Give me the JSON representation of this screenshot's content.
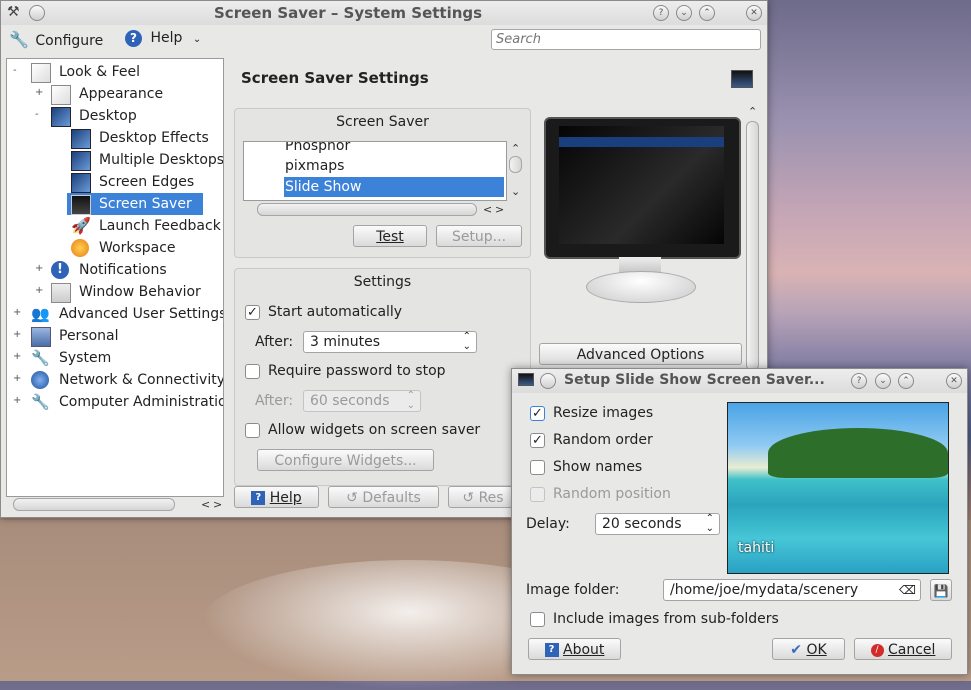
{
  "main_window": {
    "title": "Screen Saver – System Settings",
    "toolbar": {
      "configure": "Configure",
      "help": "Help"
    },
    "search": {
      "placeholder": "Search"
    },
    "tree": {
      "items": [
        {
          "label": "Look & Feel",
          "icon": "look-feel-icon",
          "level": 0
        },
        {
          "label": "Appearance",
          "icon": "appearance-icon",
          "level": 1
        },
        {
          "label": "Desktop",
          "icon": "desktop-icon",
          "level": 1
        },
        {
          "label": "Desktop Effects",
          "icon": "desktop-effects-icon",
          "level": 2
        },
        {
          "label": "Multiple Desktops",
          "icon": "multiple-desktops-icon",
          "level": 2
        },
        {
          "label": "Screen Edges",
          "icon": "screen-edges-icon",
          "level": 2
        },
        {
          "label": "Screen Saver",
          "icon": "screen-saver-icon",
          "level": 2,
          "selected": true
        },
        {
          "label": "Launch Feedback",
          "icon": "launch-feedback-icon",
          "level": 2
        },
        {
          "label": "Workspace",
          "icon": "workspace-icon",
          "level": 2
        },
        {
          "label": "Notifications",
          "icon": "notifications-icon",
          "level": 1
        },
        {
          "label": "Window Behavior",
          "icon": "window-behavior-icon",
          "level": 1
        },
        {
          "label": "Advanced User Settings",
          "icon": "advanced-user-settings-icon",
          "level": 0
        },
        {
          "label": "Personal",
          "icon": "personal-icon",
          "level": 0
        },
        {
          "label": "System",
          "icon": "system-icon",
          "level": 0
        },
        {
          "label": "Network & Connectivity",
          "icon": "network-icon",
          "level": 0
        },
        {
          "label": "Computer Administration",
          "icon": "computer-administration-icon",
          "level": 0
        }
      ]
    },
    "heading": "Screen Saver Settings",
    "screensaver_group": {
      "title": "Screen Saver",
      "list": [
        "Phosphor",
        "pixmaps",
        "Slide Show"
      ],
      "selected": "Slide Show",
      "test_button": "Test",
      "setup_button": "Setup..."
    },
    "settings_group": {
      "title": "Settings",
      "start_automatically": "Start automatically",
      "start_automatically_checked": true,
      "after_label": "After:",
      "after_value": "3 minutes",
      "require_password": "Require password to stop",
      "require_password_checked": false,
      "after2_label": "After:",
      "after2_value": "60 seconds",
      "allow_widgets": "Allow widgets on screen saver",
      "allow_widgets_checked": false,
      "configure_widgets": "Configure Widgets..."
    },
    "advanced_options": "Advanced Options",
    "footer": {
      "help": "Help",
      "defaults": "Defaults",
      "reset": "Res"
    }
  },
  "dialog": {
    "title": "Setup Slide Show Screen Saver...",
    "resize_images": "Resize images",
    "resize_images_checked": true,
    "random_order": "Random order",
    "random_order_checked": true,
    "show_names": "Show names",
    "show_names_checked": false,
    "random_position": "Random position",
    "random_position_checked": false,
    "delay_label": "Delay:",
    "delay_value": "20 seconds",
    "preview_caption": "tahiti",
    "image_folder_label": "Image folder:",
    "image_folder_value": "/home/joe/mydata/scenery",
    "include_subfolders": "Include images from sub-folders",
    "include_subfolders_checked": false,
    "about": "About",
    "ok": "OK",
    "cancel": "Cancel"
  }
}
